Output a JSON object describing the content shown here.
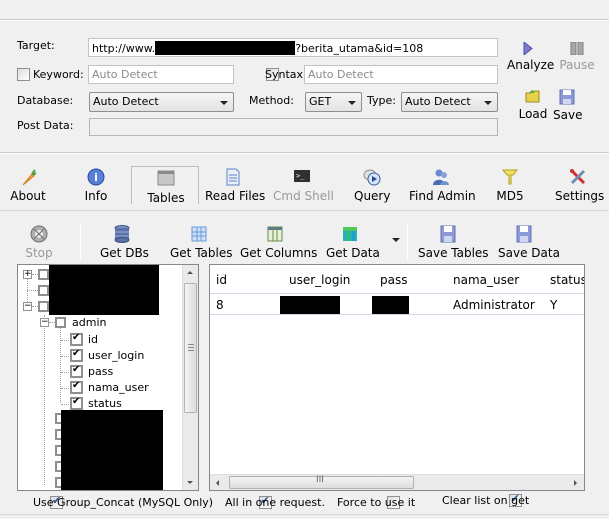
{
  "target": {
    "label": "Target:",
    "url_prefix": "http://www.",
    "url_suffix": "?berita_utama&id=108"
  },
  "keyword": {
    "label": "Keyword:",
    "checked": false,
    "value": "Auto Detect"
  },
  "syntax": {
    "label": "Syntax:",
    "checked": false,
    "value": "Auto Detect"
  },
  "database": {
    "label": "Database:",
    "selected": "Auto Detect"
  },
  "method": {
    "label": "Method:",
    "selected": "GET"
  },
  "type": {
    "label": "Type:",
    "selected": "Auto Detect"
  },
  "post_data": {
    "label": "Post Data:",
    "value": ""
  },
  "actions": {
    "analyze": "Analyze",
    "pause": "Pause",
    "load": "Load",
    "save": "Save"
  },
  "main_tabs": [
    {
      "label": "About",
      "icon": "carrot-icon"
    },
    {
      "label": "Info",
      "icon": "info-icon"
    },
    {
      "label": "Tables",
      "icon": "table-icon",
      "active": true
    },
    {
      "label": "Read Files",
      "icon": "document-icon"
    },
    {
      "label": "Cmd Shell",
      "icon": "terminal-icon",
      "disabled": true
    },
    {
      "label": "Query",
      "icon": "query-icon"
    },
    {
      "label": "Find Admin",
      "icon": "users-icon"
    },
    {
      "label": "MD5",
      "icon": "key-icon"
    },
    {
      "label": "Settings",
      "icon": "tools-icon"
    }
  ],
  "toolbar": {
    "stop": "Stop",
    "get_dbs": "Get DBs",
    "get_tables": "Get Tables",
    "get_columns": "Get Columns",
    "get_data": "Get Data",
    "save_tables": "Save Tables",
    "save_data": "Save Data"
  },
  "tree": {
    "table": "admin",
    "columns": [
      "id",
      "user_login",
      "pass",
      "nama_user",
      "status"
    ]
  },
  "grid": {
    "columns": [
      "id",
      "user_login",
      "pass",
      "nama_user",
      "status"
    ],
    "rows": [
      {
        "id": "8",
        "user_login": "",
        "pass": "",
        "nama_user": "Administrator",
        "status": "Y"
      }
    ]
  },
  "options": {
    "group_concat": {
      "label": "Use Group_Concat (MySQL Only)",
      "checked": true
    },
    "all_in_one": {
      "label": "All in one request.",
      "checked": true
    },
    "force": {
      "label": "Force to use it",
      "checked": false
    },
    "clear_list": {
      "label": "Clear list on get",
      "checked": true
    }
  }
}
